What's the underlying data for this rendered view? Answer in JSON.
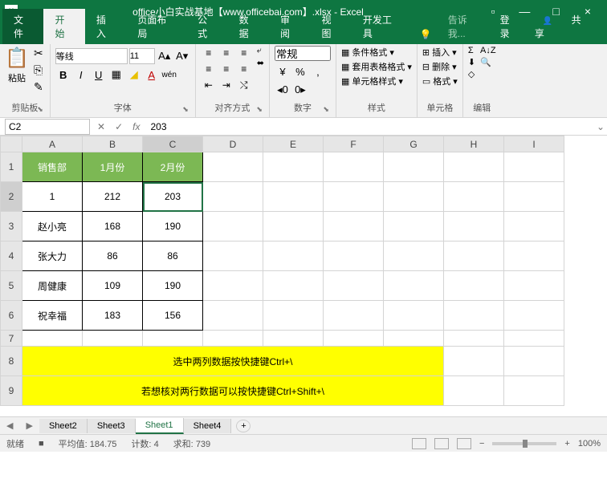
{
  "titlebar": {
    "app_icon": "X",
    "title": "office小白实战基地【www.officebai.com】.xlsx - Excel",
    "min": "—",
    "max": "□",
    "close": "×",
    "ribbon_opts": "▫"
  },
  "tabs": {
    "file": "文件",
    "items": [
      "开始",
      "插入",
      "页面布局",
      "公式",
      "数据",
      "审阅",
      "视图",
      "开发工具"
    ],
    "active_index": 0,
    "tell_me": "告诉我...",
    "login": "登录",
    "share": "共享"
  },
  "ribbon": {
    "clipboard": {
      "label": "剪贴板",
      "paste": "粘贴",
      "cut": "✂",
      "copy": "⎘",
      "painter": "✎"
    },
    "font": {
      "label": "字体",
      "name": "等线",
      "size": "11",
      "bold": "B",
      "italic": "I",
      "underline": "U",
      "border": "▦",
      "fill": "◢",
      "color": "A",
      "phonetic": "wén"
    },
    "align": {
      "label": "对齐方式",
      "wrap": "⤶",
      "merge": "⬌"
    },
    "number": {
      "label": "数字",
      "format": "常规",
      "currency": "¥",
      "percent": "%",
      "comma": ",",
      "inc": "◂0",
      "dec": "0▸"
    },
    "styles": {
      "label": "样式",
      "cond": "条件格式",
      "table": "套用表格格式",
      "cell": "单元格样式"
    },
    "cells": {
      "label": "单元格",
      "insert": "插入",
      "delete": "删除",
      "format": "格式"
    },
    "editing": {
      "label": "编辑",
      "sum": "Σ",
      "fill": "⬇",
      "clear": "◇",
      "sort": "A↓Z",
      "find": "🔍"
    }
  },
  "namebox": {
    "ref": "C2",
    "fx": "fx",
    "formula": "203",
    "cancel": "✕",
    "enter": "✓"
  },
  "grid": {
    "cols": [
      "A",
      "B",
      "C",
      "D",
      "E",
      "F",
      "G",
      "H",
      "I"
    ],
    "rows": [
      "1",
      "2",
      "3",
      "4",
      "5",
      "6",
      "7",
      "8",
      "9"
    ],
    "headers": [
      "销售部",
      "1月份",
      "2月份"
    ],
    "data": [
      [
        "1",
        "212",
        "203"
      ],
      [
        "赵小亮",
        "168",
        "190"
      ],
      [
        "张大力",
        "86",
        "86"
      ],
      [
        "周健康",
        "109",
        "190"
      ],
      [
        "祝幸福",
        "183",
        "156"
      ]
    ],
    "note1": "选中两列数据按快捷键Ctrl+\\",
    "note2": "若想核对两行数据可以按快捷键Ctrl+Shift+\\"
  },
  "sheets": {
    "items": [
      "Sheet2",
      "Sheet3",
      "Sheet1",
      "Sheet4"
    ],
    "active_index": 2,
    "add": "+",
    "nav_l": "◀",
    "nav_r": "▶"
  },
  "status": {
    "ready": "就绪",
    "rec": "■",
    "avg_l": "平均值:",
    "avg_v": "184.75",
    "cnt_l": "计数:",
    "cnt_v": "4",
    "sum_l": "求和:",
    "sum_v": "739",
    "zoom_out": "−",
    "zoom_in": "+",
    "zoom": "100%"
  }
}
